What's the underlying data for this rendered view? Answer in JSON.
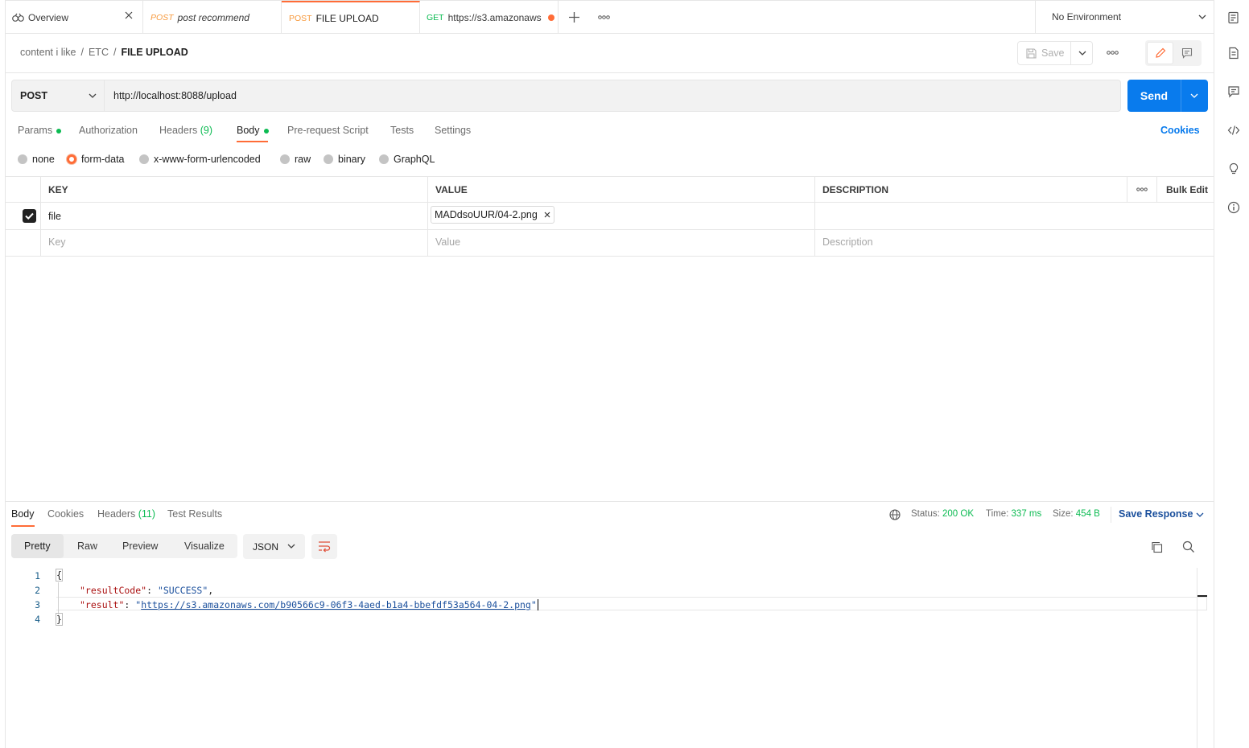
{
  "tabs": [
    {
      "method": "",
      "label": "Overview",
      "icon": "overview-icon"
    },
    {
      "method": "POST",
      "label": "post recommend"
    },
    {
      "method": "POST",
      "label": "FILE UPLOAD"
    },
    {
      "method": "GET",
      "label": "https://s3.amazonaws"
    }
  ],
  "environment": {
    "label": "No Environment"
  },
  "breadcrumb": {
    "parts": [
      "content i like",
      "ETC",
      "FILE UPLOAD"
    ],
    "separator": "/"
  },
  "toolbar": {
    "save_label": "Save"
  },
  "request": {
    "method": "POST",
    "url": "http://localhost:8088/upload",
    "send_label": "Send"
  },
  "request_tabs": {
    "params": "Params",
    "authorization": "Authorization",
    "headers": "Headers",
    "headers_count": "(9)",
    "body": "Body",
    "prerequest": "Pre-request Script",
    "tests": "Tests",
    "settings": "Settings",
    "cookies": "Cookies"
  },
  "body_types": [
    "none",
    "form-data",
    "x-www-form-urlencoded",
    "raw",
    "binary",
    "GraphQL"
  ],
  "body_type_selected": "form-data",
  "table": {
    "headers": {
      "key": "KEY",
      "value": "VALUE",
      "description": "DESCRIPTION",
      "bulk_edit": "Bulk Edit"
    },
    "rows": [
      {
        "key": "file",
        "value": "MADdsoUUR/04-2.png",
        "description": "",
        "checked": true
      }
    ],
    "placeholders": {
      "key": "Key",
      "value": "Value",
      "description": "Description"
    }
  },
  "response": {
    "tabs": {
      "body": "Body",
      "cookies": "Cookies",
      "headers": "Headers",
      "headers_count": "(11)",
      "tests": "Test Results"
    },
    "status_label": "Status:",
    "status": "200 OK",
    "time_label": "Time:",
    "time": "337 ms",
    "size_label": "Size:",
    "size": "454 B",
    "save_response": "Save Response",
    "view_modes": [
      "Pretty",
      "Raw",
      "Preview",
      "Visualize"
    ],
    "format": "JSON",
    "code": {
      "line_numbers": [
        "1",
        "2",
        "3",
        "4"
      ],
      "open_brace": "{",
      "close_brace": "}",
      "k1": "\"resultCode\"",
      "v1": "\"SUCCESS\"",
      "k2": "\"result\"",
      "v2_url": "https://s3.amazonaws.com/b90566c9-06f3-4aed-b1a4-bbefdf53a564-04-2.png"
    }
  },
  "colors": {
    "accent": "#ff6c37",
    "send": "#097bed",
    "success": "#0cbb52",
    "post": "#f79a3e"
  }
}
